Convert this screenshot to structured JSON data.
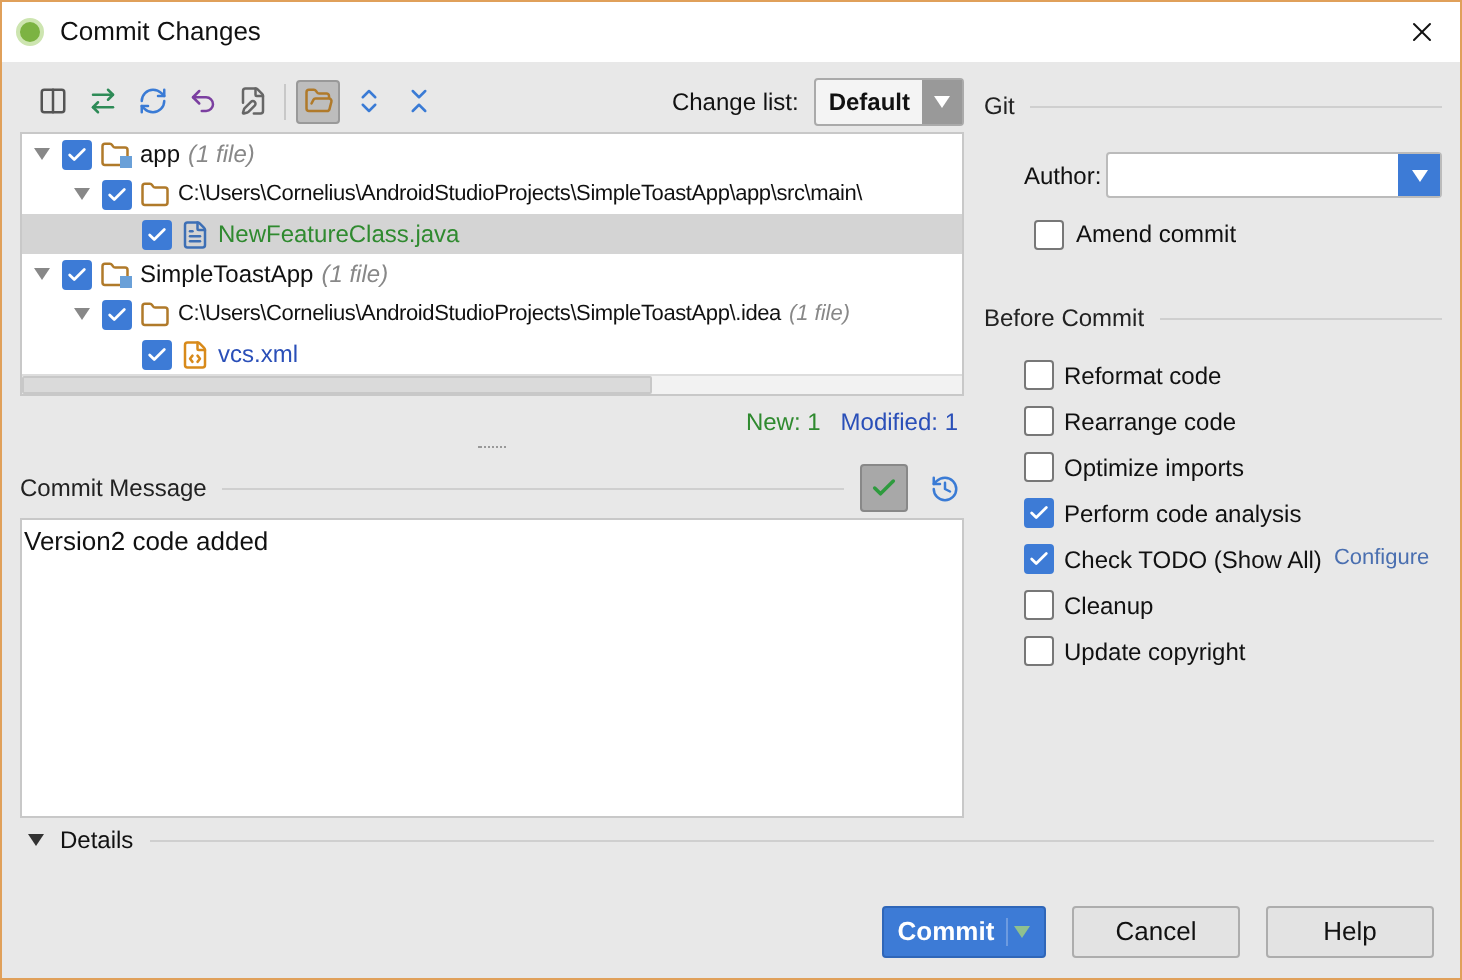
{
  "window": {
    "title": "Commit Changes"
  },
  "toolbar": {
    "tools": [
      {
        "kind": "diff",
        "selected": false
      },
      {
        "kind": "move",
        "selected": false
      },
      {
        "kind": "refresh",
        "selected": false
      },
      {
        "kind": "rollback",
        "selected": false
      },
      {
        "kind": "edit",
        "selected": false
      },
      {
        "kind": "group",
        "selected": true
      },
      {
        "kind": "expand",
        "selected": false
      },
      {
        "kind": "collapse",
        "selected": false
      }
    ],
    "change_list": {
      "label": "Change list:",
      "value": "Default"
    }
  },
  "tree": [
    {
      "kind": "module",
      "label": "app",
      "count": "(1 file)",
      "checked": true,
      "expanded": true,
      "selected": false,
      "children": [
        {
          "kind": "folder",
          "label": "C:\\Users\\Cornelius\\AndroidStudioProjects\\SimpleToastApp\\app\\src\\main\\",
          "checked": true,
          "expanded": true,
          "selected": false,
          "children": [
            {
              "kind": "java",
              "label": "NewFeatureClass.java",
              "color": "#2f8a2f",
              "checked": true,
              "selected": true
            }
          ]
        }
      ]
    },
    {
      "kind": "module",
      "label": "SimpleToastApp",
      "count": "(1 file)",
      "checked": true,
      "expanded": true,
      "selected": false,
      "children": [
        {
          "kind": "folder",
          "label": "C:\\Users\\Cornelius\\AndroidStudioProjects\\SimpleToastApp\\.idea",
          "count": "(1 file)",
          "checked": true,
          "expanded": true,
          "selected": false,
          "children": [
            {
              "kind": "xml",
              "label": "vcs.xml",
              "color": "#2a4fb8",
              "checked": true,
              "selected": false
            }
          ]
        }
      ]
    }
  ],
  "summary": {
    "new": "New: 1",
    "modified": "Modified: 1"
  },
  "commit_message": {
    "label": "Commit Message",
    "value": "Version2 code added",
    "spellcheck_on": true
  },
  "git": {
    "title": "Git",
    "author_label": "Author:",
    "amend": {
      "label": "Amend commit",
      "checked": false
    }
  },
  "before_commit": {
    "title": "Before Commit",
    "options": [
      {
        "label": "Reformat code",
        "checked": false
      },
      {
        "label": "Rearrange code",
        "checked": false
      },
      {
        "label": "Optimize imports",
        "checked": false
      },
      {
        "label": "Perform code analysis",
        "checked": true
      },
      {
        "label": "Check TODO (Show All)",
        "checked": true,
        "link": "Configure"
      },
      {
        "label": "Cleanup",
        "checked": false
      },
      {
        "label": "Update copyright",
        "checked": false
      }
    ]
  },
  "details": {
    "label": "Details",
    "expanded": false
  },
  "buttons": [
    {
      "label": "Commit",
      "kind": "primary"
    },
    {
      "label": "Cancel",
      "kind": "normal"
    },
    {
      "label": "Help",
      "kind": "normal"
    }
  ]
}
